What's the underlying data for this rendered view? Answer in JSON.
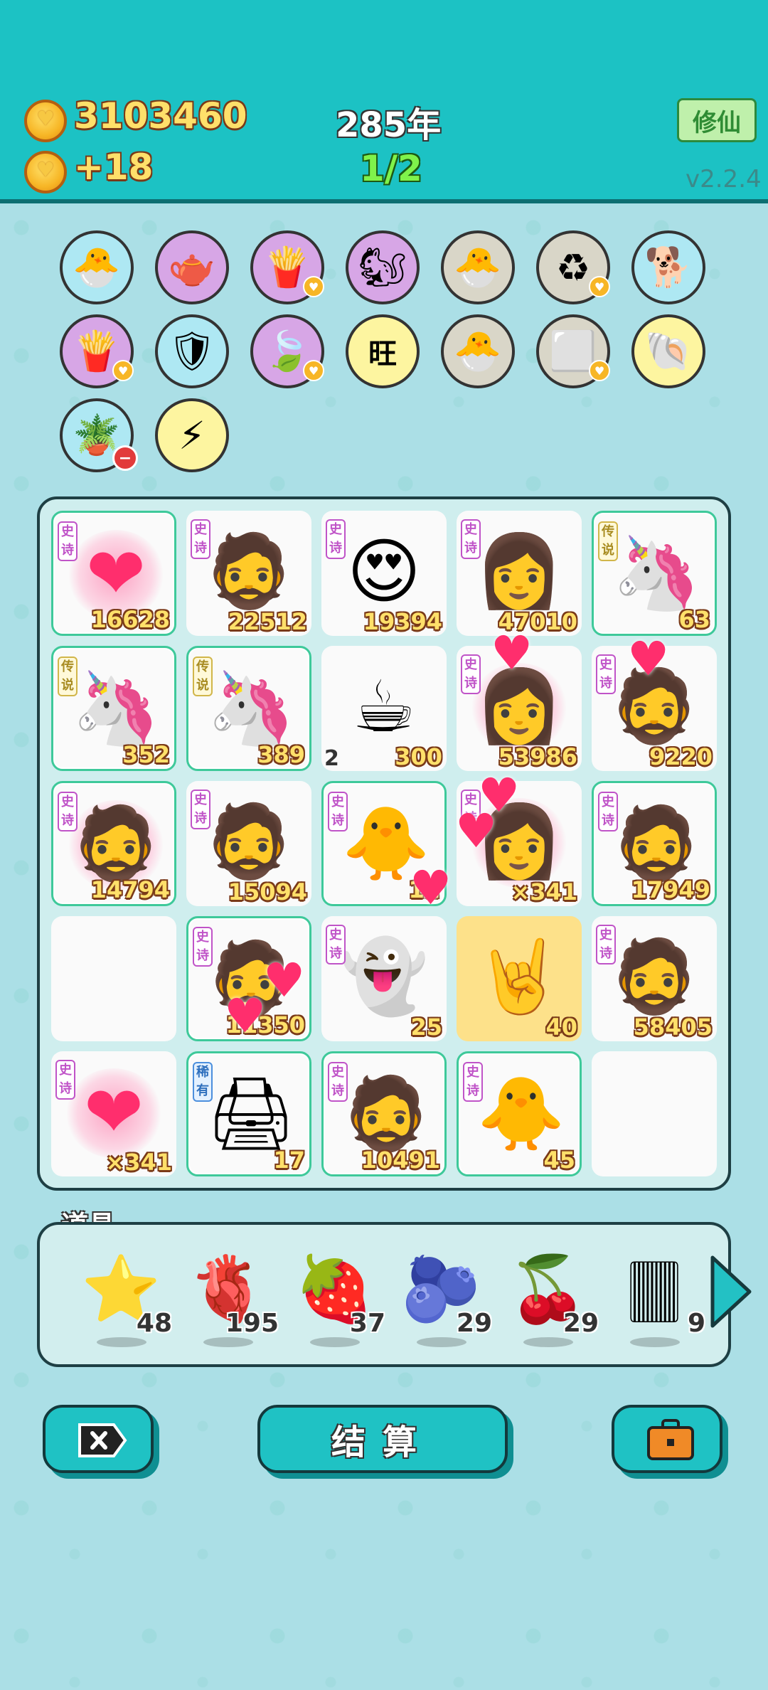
{
  "header": {
    "coins": "3103460",
    "coin_rate": "+18",
    "years": "285年",
    "stage": "1/2",
    "xiuxian_label": "修仙",
    "version": "v2.2.4"
  },
  "buffs": [
    {
      "name": "chick-egg-icon",
      "glyph": "🐣",
      "bg": "#aee8f3"
    },
    {
      "name": "gravy-boat-icon",
      "glyph": "🫖",
      "bg": "#d7a6e6"
    },
    {
      "name": "fries-icon",
      "glyph": "🍟",
      "bg": "#d7a6e6",
      "badge": "heart"
    },
    {
      "name": "meerkats-icon",
      "glyph": "🐿",
      "bg": "#d7a6e6"
    },
    {
      "name": "chick-egg-icon",
      "glyph": "🐣",
      "bg": "#d9d6c8"
    },
    {
      "name": "recycle-icon",
      "glyph": "♻",
      "bg": "#d9d6c8",
      "badge": "heart"
    },
    {
      "name": "dog-icon",
      "glyph": "🐕",
      "bg": "#aee8f3"
    },
    {
      "name": "fries-icon",
      "glyph": "🍟",
      "bg": "#d7a6e6",
      "badge": "heart"
    },
    {
      "name": "shield-wrench-icon",
      "glyph": "🛡",
      "bg": "#aee8f3"
    },
    {
      "name": "leaf-icon",
      "glyph": "🍃",
      "bg": "#d7a6e6",
      "badge": "heart"
    },
    {
      "name": "wang-icon",
      "glyph": "旺",
      "bg": "#fdf5a0"
    },
    {
      "name": "chick-egg-icon",
      "glyph": "🐣",
      "bg": "#d9d6c8"
    },
    {
      "name": "sugar-cubes-icon",
      "glyph": "⬜",
      "bg": "#d9d6c8",
      "badge": "heart"
    },
    {
      "name": "shell-icon",
      "glyph": "🐚",
      "bg": "#fdf5a0"
    },
    {
      "name": "flower-pot-icon",
      "glyph": "🪴",
      "bg": "#aee8f3",
      "badge": "minus"
    },
    {
      "name": "lightning-icon",
      "glyph": "⚡",
      "bg": "#fdf5a0"
    }
  ],
  "tag_labels": {
    "epic": "史诗",
    "legend": "传说",
    "rare": "稀有"
  },
  "board": [
    {
      "art": "❤",
      "tag": "epic",
      "num": "16628",
      "glow": true,
      "heartglow": true
    },
    {
      "art": "🧔",
      "tag": "epic",
      "num": "22512"
    },
    {
      "art": "😍",
      "tag": "epic",
      "num": "19394"
    },
    {
      "art": "👩",
      "tag": "epic",
      "num": "47010"
    },
    {
      "art": "🦄",
      "tag": "legend",
      "num": "63",
      "glow": true
    },
    {
      "art": "🦄",
      "tag": "legend",
      "num": "352",
      "glow": true
    },
    {
      "art": "🦄",
      "tag": "legend",
      "num": "389",
      "glow": true
    },
    {
      "art": "☕",
      "tag": "",
      "num": "300",
      "left": "2"
    },
    {
      "art": "👩",
      "tag": "epic",
      "num": "53986",
      "heartglow": true
    },
    {
      "art": "🧔",
      "tag": "epic",
      "num": "9220"
    },
    {
      "art": "🧔",
      "tag": "epic",
      "num": "14794",
      "glow": true,
      "heartglow": true
    },
    {
      "art": "🧔",
      "tag": "epic",
      "num": "15094"
    },
    {
      "art": "🐥",
      "tag": "epic",
      "num": "12",
      "glow": true
    },
    {
      "art": "👩",
      "tag": "epic",
      "num": "×341",
      "heartglow": true
    },
    {
      "art": "🧔",
      "tag": "epic",
      "num": "17949",
      "glow": true
    },
    {
      "art": "",
      "tag": "",
      "num": ""
    },
    {
      "art": "🧔",
      "tag": "epic",
      "num": "11350",
      "glow": true
    },
    {
      "art": "👻",
      "tag": "epic",
      "num": "25"
    },
    {
      "art": "🤘",
      "tag": "",
      "num": "40",
      "yellow": true
    },
    {
      "art": "🧔",
      "tag": "epic",
      "num": "58405"
    },
    {
      "art": "❤",
      "tag": "epic",
      "num": "×341",
      "heartglow": true
    },
    {
      "art": "🖨",
      "tag": "rare",
      "num": "17",
      "glow": true
    },
    {
      "art": "🧔",
      "tag": "epic",
      "num": "10491",
      "glow": true
    },
    {
      "art": "🐥",
      "tag": "epic",
      "num": "45",
      "glow": true
    },
    {
      "art": "",
      "tag": "",
      "num": ""
    }
  ],
  "tools": {
    "title": "道具",
    "items": [
      {
        "name": "star-icon",
        "glyph": "⭐",
        "count": "48"
      },
      {
        "name": "liver-icon",
        "glyph": "🫀",
        "count": "195"
      },
      {
        "name": "strawberry-icon",
        "glyph": "🍓",
        "count": "37"
      },
      {
        "name": "blueberry-icon",
        "glyph": "🫐",
        "count": "29"
      },
      {
        "name": "bayberry-icon",
        "glyph": "🍒",
        "count": "29"
      },
      {
        "name": "rare-cards-icon",
        "glyph": "🀫",
        "count": "9"
      }
    ]
  },
  "buttons": {
    "settle_label": "结算"
  },
  "colors": {
    "header_bg": "#1cc2c4",
    "accent_teal": "#1fc2c4",
    "gold": "#ffe06a",
    "green": "#7ff24b"
  }
}
